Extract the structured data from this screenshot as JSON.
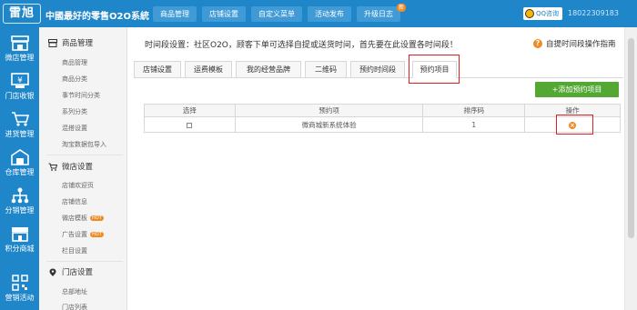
{
  "header": {
    "logo": "雷旭",
    "slogan": "中國最好的零售O2O系統",
    "nav": [
      {
        "label": "商品管理",
        "badge": ""
      },
      {
        "label": "店铺设置",
        "badge": ""
      },
      {
        "label": "自定义菜单",
        "badge": ""
      },
      {
        "label": "活动发布",
        "badge": ""
      },
      {
        "label": "升级日志",
        "badge": "新"
      }
    ],
    "qq_label": "QQ咨询",
    "phone": "18022309183"
  },
  "rail": [
    {
      "label": "微店管理",
      "icon": "store-icon"
    },
    {
      "label": "门店收银",
      "icon": "cashier-icon"
    },
    {
      "label": "进货管理",
      "icon": "cart-icon"
    },
    {
      "label": "仓库管理",
      "icon": "warehouse-icon"
    },
    {
      "label": "分销管理",
      "icon": "org-icon"
    },
    {
      "label": "积分商城",
      "icon": "mall-icon"
    },
    {
      "label": "营销活动",
      "icon": "qr-icon"
    }
  ],
  "sidebar": {
    "sections": [
      {
        "title": "商品管理",
        "items": [
          "商品管理",
          "商品分类",
          "事节时间分类",
          "系列分类",
          "混搭设置",
          "淘宝数据包导入"
        ]
      },
      {
        "title": "微店设置",
        "items": [
          "店铺欢迎页",
          "店铺信息",
          "微店模板",
          "广告设置",
          "栏目设置"
        ]
      },
      {
        "title": "门店设置",
        "items": [
          "总部地址",
          "门店列表"
        ]
      }
    ],
    "hot_badge": "HOT"
  },
  "main": {
    "notice": "时间段设置：社区O2O，顾客下单可选择自提或送货时间，首先要在此设置各时间段！",
    "guide": "自提时间段操作指南",
    "tabs": [
      "店铺设置",
      "运费模板",
      "我的经营品牌",
      "二维码",
      "预约时间段",
      "预约项目"
    ],
    "active_tab": "预约项目",
    "add_button": "+添加预约项目",
    "table": {
      "headers": [
        "选择",
        "预约项",
        "排序码",
        "操作"
      ],
      "rows": [
        {
          "name": "微商城新系统体验",
          "sort": "1"
        }
      ]
    }
  }
}
